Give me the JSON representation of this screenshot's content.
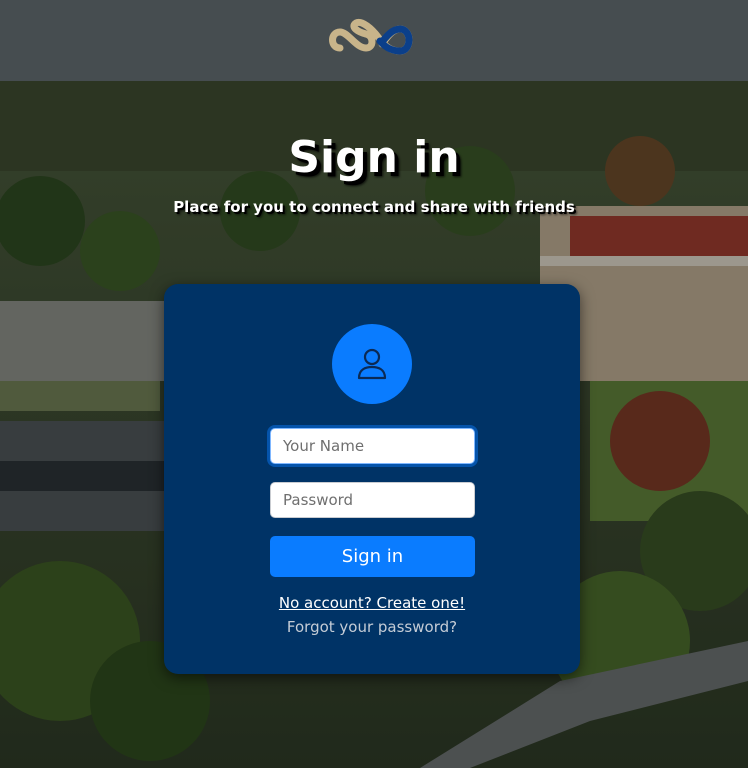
{
  "header": {
    "logo_icon": "infinity-logo-icon",
    "logo_colors": [
      "#c8b48a",
      "#0b3f8a"
    ]
  },
  "hero": {
    "title": "Sign in",
    "subtitle": "Place for you to connect and share with friends"
  },
  "form": {
    "avatar_icon": "user-icon",
    "name_placeholder": "Your Name",
    "name_value": "",
    "password_placeholder": "Password",
    "password_value": "",
    "submit_label": "Sign in",
    "create_account_label": "No account? Create one!",
    "forgot_password_label": "Forgot your password?"
  },
  "colors": {
    "header_bg": "#464d50",
    "card_bg": "#003366",
    "accent": "#0a7cff"
  }
}
